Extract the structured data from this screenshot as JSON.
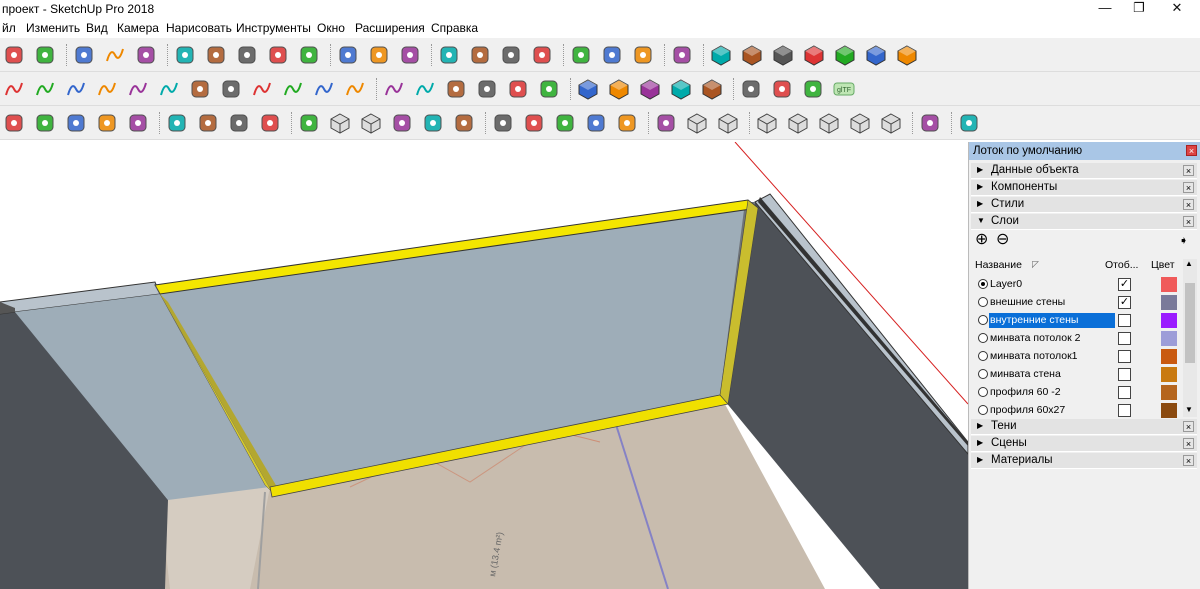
{
  "window": {
    "title": "проект - SketchUp Pro 2018",
    "minimize_glyph": "—",
    "maximize_glyph": "❐",
    "close_glyph": "✕"
  },
  "menu": [
    "йл",
    "Изменить",
    "Вид",
    "Камера",
    "Нарисовать",
    "Инструменты",
    "Окно",
    "Расширения",
    "Справка"
  ],
  "toolbars": {
    "row1_icons": [
      "select-icon",
      "eraser-icon",
      "pencil-line-icon",
      "arc-icon",
      "paint-bucket-icon",
      "push-pull-icon",
      "follow-me-icon",
      "move-icon",
      "rotate-icon",
      "scale-icon",
      "tape-measure-icon",
      "text-icon",
      "paint-icon",
      "orbit-icon",
      "pan-icon",
      "zoom-icon",
      "zoom-extents-icon",
      "warehouse-icon",
      "extension-warehouse-icon",
      "send-layout-icon",
      "ruby-icon",
      "view-iso-icon",
      "view-top-icon",
      "view-front-icon",
      "view-right-icon",
      "view-back-icon",
      "view-left-icon",
      "view-bottom-icon"
    ],
    "row2_icons": [
      "curve-1-icon",
      "curve-2-icon",
      "curve-3-icon",
      "curve-4-icon",
      "curve-5-icon",
      "curve-6-icon",
      "circle-icon",
      "spiral-icon",
      "arc-2-icon",
      "zigzag-icon",
      "hook-icon",
      "arc-3-icon",
      "arc-4-icon",
      "line-curve-icon",
      "polygon-icon",
      "wrench-icon",
      "ellipse-icon",
      "triangle-icon",
      "solid-union-icon",
      "solid-up-icon",
      "solid-subtract-icon",
      "solid-intersect-icon",
      "solid-trim-icon",
      "shadow-icon",
      "bulb-icon",
      "section-icon",
      "gltf-icon"
    ],
    "row3_icons": [
      "check-icon",
      "teapot-icon",
      "teapot-camera-icon",
      "cloud-icon",
      "scene-icon",
      "window-icon",
      "photo-icon",
      "photo-2-icon",
      "lock-icon",
      "sandbox-icon",
      "cube-icon",
      "cube-2-icon",
      "grass-icon",
      "stamp-icon",
      "draw-icon",
      "drape-icon",
      "smoove-icon",
      "flip-icon",
      "add-detail-icon",
      "dome-icon",
      "round-icon",
      "xray-icon",
      "back-edges-icon",
      "wireframe-icon",
      "hidden-line-icon",
      "shaded-icon",
      "textured-icon",
      "monochrome-icon",
      "component-edit-icon",
      "globe-icon"
    ],
    "gltf_label": "glTF"
  },
  "tray": {
    "title": "Лоток по умолчанию",
    "panels_top": [
      {
        "label": "Данные объекта",
        "expanded": false
      },
      {
        "label": "Компоненты",
        "expanded": false
      },
      {
        "label": "Стили",
        "expanded": false
      },
      {
        "label": "Слои",
        "expanded": true
      }
    ],
    "panels_bottom": [
      {
        "label": "Тени",
        "expanded": false
      },
      {
        "label": "Сцены",
        "expanded": false
      },
      {
        "label": "Материалы",
        "expanded": false
      }
    ],
    "layers": {
      "add_glyph": "⊕",
      "remove_glyph": "⊖",
      "col_name": "Название",
      "col_visible": "Отоб...",
      "col_color": "Цвет",
      "rows": [
        {
          "name": "Layer0",
          "active": true,
          "visible": true,
          "selected": false,
          "color": "#f05a5a"
        },
        {
          "name": "внешние стены",
          "active": false,
          "visible": true,
          "selected": false,
          "color": "#7a7a9a"
        },
        {
          "name": "внутренние стены",
          "active": false,
          "visible": false,
          "selected": true,
          "color": "#9b1bff"
        },
        {
          "name": "минвата потолок 2",
          "active": false,
          "visible": false,
          "selected": false,
          "color": "#9d9dd8"
        },
        {
          "name": "минвата потолок1",
          "active": false,
          "visible": false,
          "selected": false,
          "color": "#c95a10"
        },
        {
          "name": "минвата стена",
          "active": false,
          "visible": false,
          "selected": false,
          "color": "#c97a10"
        },
        {
          "name": "профиля 60 -2",
          "active": false,
          "visible": false,
          "selected": false,
          "color": "#b5651d"
        },
        {
          "name": "профиля 60х27",
          "active": false,
          "visible": false,
          "selected": false,
          "color": "#8b4a0f"
        }
      ]
    }
  },
  "viewport": {
    "floor_dimension_text": "м (13.4 m²)"
  }
}
